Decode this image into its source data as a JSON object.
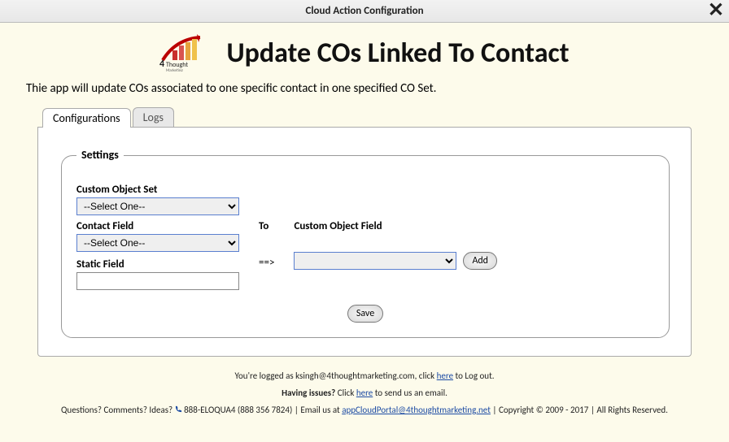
{
  "titlebar": {
    "text": "Cloud Action Configuration"
  },
  "header": {
    "title": "Update COs Linked To Contact",
    "logo_alt": "4Thought Marketing"
  },
  "intro": "Thie app will update COs associated to one specific contact in one specified CO Set.",
  "tabs": {
    "configurations": "Configurations",
    "logs": "Logs"
  },
  "settings": {
    "legend": "Settings",
    "custom_object_set_label": "Custom Object Set",
    "custom_object_set_value": "--Select One--",
    "contact_field_label": "Contact Field",
    "contact_field_value": "--Select One--",
    "static_field_label": "Static Field",
    "static_field_value": "",
    "to_label": "To",
    "custom_object_field_label": "Custom Object Field",
    "custom_object_field_value": "",
    "arrow": "==>",
    "add_button": "Add",
    "save_button": "Save"
  },
  "footer": {
    "logged_pre": "You're logged as ",
    "logged_user": "ksingh@4thoughtmarketing.com",
    "logged_mid": ", click ",
    "here": "here",
    "logged_post": " to Log out.",
    "issues_pre": "Having issues? ",
    "issues_mid": "Click ",
    "issues_post": " to send us an email.",
    "q_pre": "Questions? Comments? Ideas? ",
    "phone": "888-ELOQUA4 (888 356 7824)",
    "sep": " | ",
    "email_pre": "Email us at ",
    "email": "appCloudPortal@4thoughtmarketing.net",
    "copyright": "Copyright © 2009 - 2017",
    "rights": "All Rights Reserved."
  }
}
